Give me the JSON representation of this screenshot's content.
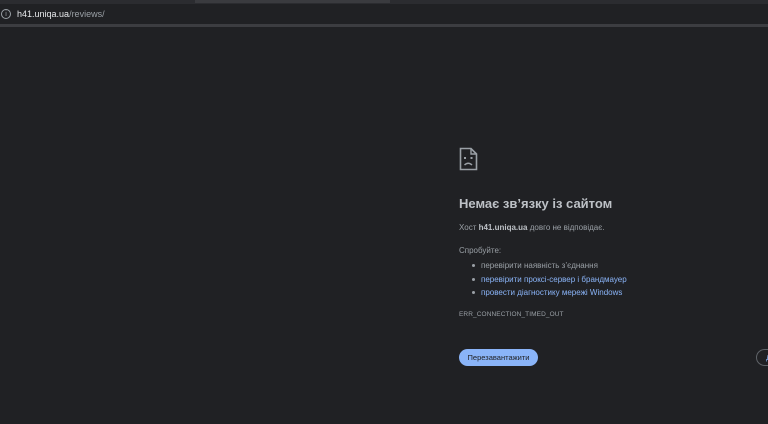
{
  "browser": {
    "url_host": "h41.uniqa.ua",
    "url_path": "/reviews/",
    "site_info_icon": "info-icon"
  },
  "error_page": {
    "icon": "sad-document-icon",
    "title": "Немає зв’язку із сайтом",
    "desc_prefix": "Хост ",
    "desc_host": "h41.uniqa.ua",
    "desc_suffix": " довго не відповідає.",
    "try_label": "Спробуйте:",
    "suggestions": [
      {
        "label": "перевірити наявність з’єднання",
        "link": false
      },
      {
        "label": "перевірити проксі-сервер і брандмауер",
        "link": true
      },
      {
        "label": "провести діагностику мережі Windows",
        "link": true
      }
    ],
    "error_code": "ERR_CONNECTION_TIMED_OUT",
    "reload_label": "Перезавантажити",
    "details_label": "Д"
  },
  "colors": {
    "background": "#202124",
    "accent_blue": "#8ab4f8",
    "text_secondary": "#9aa0a6",
    "title": "#bdc1c6"
  }
}
